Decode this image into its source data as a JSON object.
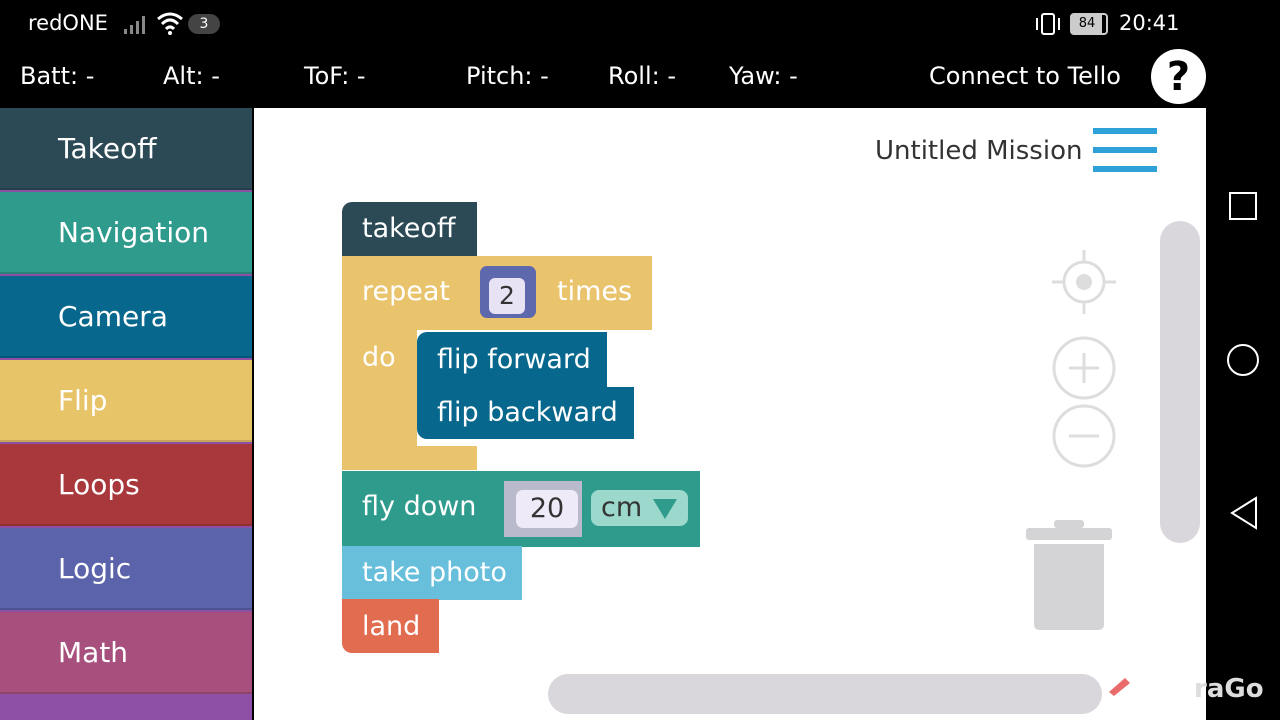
{
  "status_bar": {
    "carrier": "redONE",
    "notification_count": "3",
    "battery": "84",
    "time": "20:41"
  },
  "telemetry": {
    "batt": "Batt: -",
    "alt": "Alt: -",
    "tof": "ToF: -",
    "pitch": "Pitch: -",
    "roll": "Roll: -",
    "yaw": "Yaw: -",
    "connect": "Connect to Tello",
    "help": "?"
  },
  "categories": [
    {
      "label": "Takeoff",
      "color": "#2c4a56"
    },
    {
      "label": "Navigation",
      "color": "#2e9b8c"
    },
    {
      "label": "Camera",
      "color": "#08678c"
    },
    {
      "label": "Flip",
      "color": "#e8c468"
    },
    {
      "label": "Loops",
      "color": "#a8383b"
    },
    {
      "label": "Logic",
      "color": "#5b63ab"
    },
    {
      "label": "Math",
      "color": "#a7507e"
    }
  ],
  "workspace": {
    "mission_title": "Untitled Mission"
  },
  "blocks": {
    "takeoff": "takeoff",
    "repeat": "repeat",
    "repeat_count": "2",
    "times": "times",
    "do": "do",
    "flip_forward": "flip forward",
    "flip_backward": "flip backward",
    "fly_down": "fly down",
    "fly_down_value": "20",
    "unit": "cm",
    "take_photo": "take photo",
    "land": "land"
  },
  "watermark": "raGo"
}
